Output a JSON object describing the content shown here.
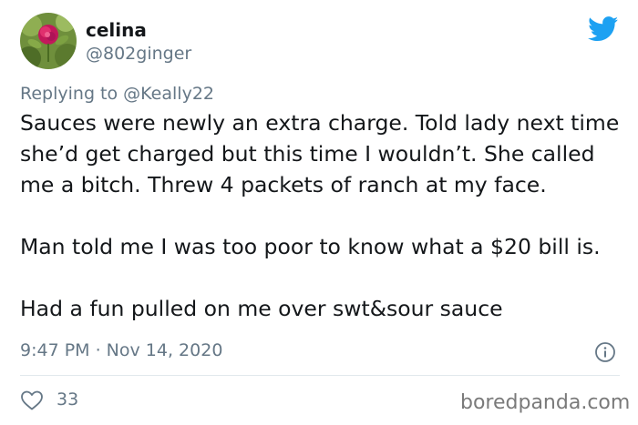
{
  "author": {
    "display_name": "celina",
    "handle": "@802ginger"
  },
  "reply": {
    "prefix": "Replying to",
    "mention": "@Keally22"
  },
  "tweet": {
    "paragraphs": [
      "Sauces were newly an extra charge. Told lady next time she’d get charged but this time I wouldn’t. She called me a bitch. Threw 4 packets of ranch at my face.",
      "Man told me I was too poor to know what a $20 bill is.",
      "Had a fun pulled on me over swt&sour sauce"
    ],
    "timestamp": "9:47 PM · Nov 14, 2020",
    "likes": "33"
  },
  "watermark": "boredpanda.com",
  "icons": {
    "brand": "twitter-bird-icon",
    "info": "info-icon",
    "like": "heart-icon"
  },
  "colors": {
    "twitter_blue": "#1da1f2",
    "secondary_text": "#657786",
    "primary_text": "#14171a",
    "divider": "#e1e8ed"
  }
}
